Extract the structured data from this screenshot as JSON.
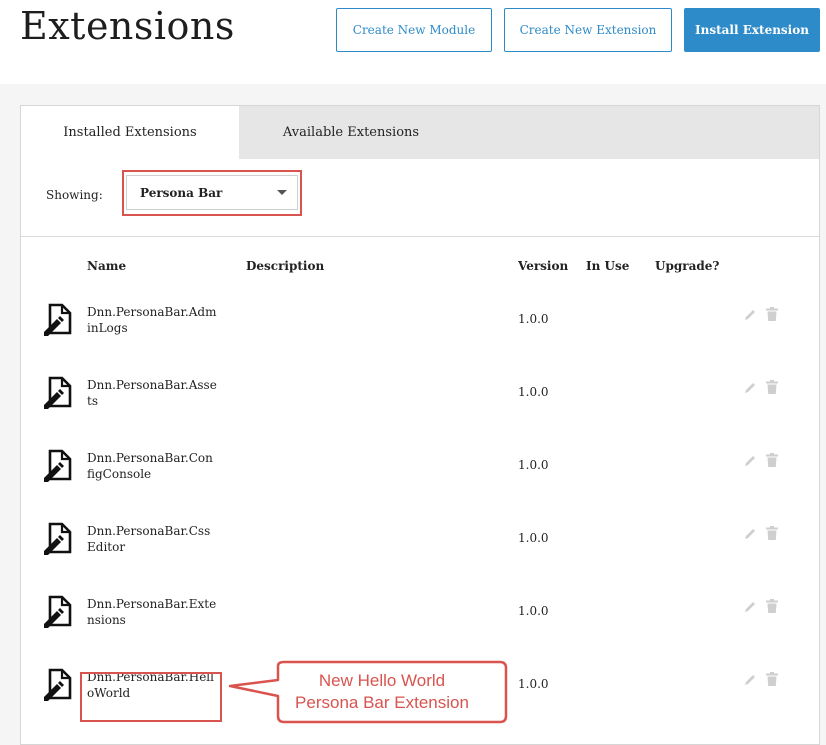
{
  "header": {
    "title": "Extensions",
    "buttons": {
      "create_module": "Create New Module",
      "create_extension": "Create New Extension",
      "install_extension": "Install Extension"
    }
  },
  "tabs": [
    {
      "label": "Installed Extensions",
      "active": true
    },
    {
      "label": "Available Extensions",
      "active": false
    }
  ],
  "filter": {
    "label": "Showing:",
    "selected": "Persona Bar"
  },
  "columns": [
    "Name",
    "Description",
    "Version",
    "In Use",
    "Upgrade?"
  ],
  "rows": [
    {
      "name": "Dnn.PersonaBar.AdminLogs",
      "description": "",
      "version": "1.0.0",
      "in_use": "",
      "upgrade": ""
    },
    {
      "name": "Dnn.PersonaBar.Assets",
      "description": "",
      "version": "1.0.0",
      "in_use": "",
      "upgrade": ""
    },
    {
      "name": "Dnn.PersonaBar.ConfigConsole",
      "description": "",
      "version": "1.0.0",
      "in_use": "",
      "upgrade": ""
    },
    {
      "name": "Dnn.PersonaBar.CssEditor",
      "description": "",
      "version": "1.0.0",
      "in_use": "",
      "upgrade": ""
    },
    {
      "name": "Dnn.PersonaBar.Extensions",
      "description": "",
      "version": "1.0.0",
      "in_use": "",
      "upgrade": ""
    },
    {
      "name": "Dnn.PersonaBar.HelloWorld",
      "description": "",
      "version": "1.0.0",
      "in_use": "",
      "upgrade": ""
    }
  ],
  "row_icons": [
    "module-package-icon",
    "edit-icon",
    "trash-icon"
  ],
  "annotation": {
    "line1": "New Hello World",
    "line2": "Persona Bar Extension"
  },
  "colors": {
    "accent": "#2e8bc9",
    "annotation": "#d9534f",
    "tab_inactive": "#e6e6e6"
  }
}
